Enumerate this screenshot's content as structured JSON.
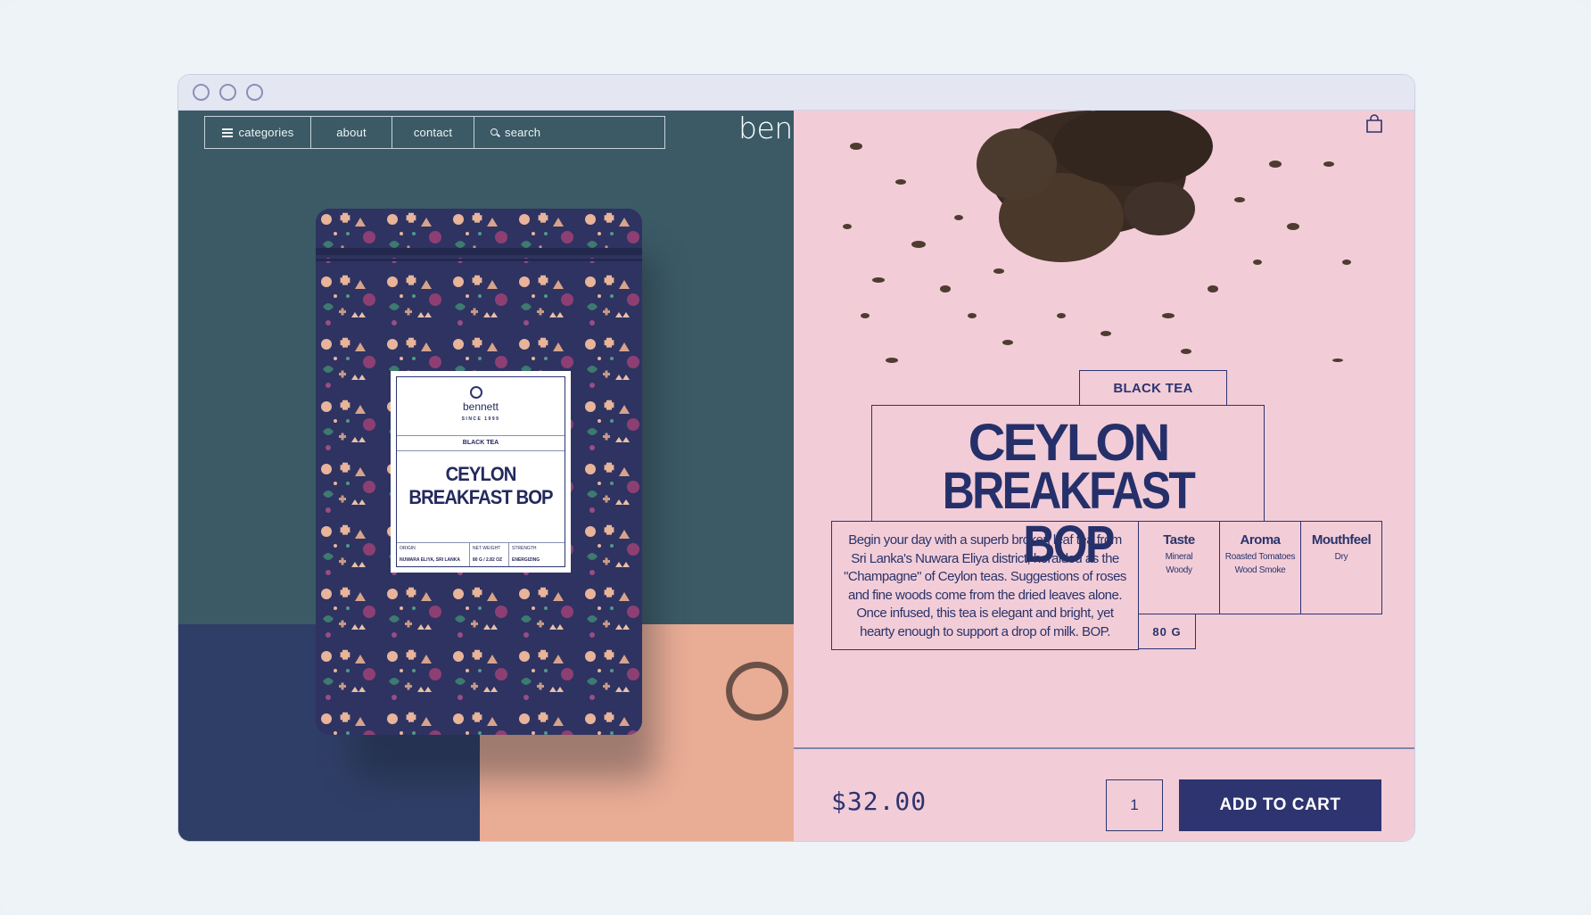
{
  "brand": {
    "name": "bennett"
  },
  "nav": {
    "categories": "categories",
    "about": "about",
    "contact": "contact",
    "search": "search"
  },
  "tin_label": {
    "brand": "bennett",
    "since": "SINCE 1999",
    "type": "BLACK TEA",
    "name_line1": "CEYLON",
    "name_line2": "BREAKFAST BOP",
    "origin_label": "ORIGIN",
    "origin_value": "NUWARA ELIYA, SRI LANKA",
    "weight_label": "NET WEIGHT",
    "weight_value": "80 G / 2.82 OZ",
    "strength_label": "STRENGTH",
    "strength_value": "ENERGIZING"
  },
  "product": {
    "type": "BLACK TEA",
    "title_line1": "CEYLON",
    "title_line2": "BREAKFAST BOP",
    "description": "Begin your day with a superb broken leaf tea from Sri Lanka's Nuwara Eliya district, heralded as the \"Champagne\" of Ceylon teas. Suggestions of roses and fine woods come from the dried leaves alone. Once infused, this tea is elegant and bright, yet hearty enough to support a drop of milk. BOP.",
    "attributes": [
      {
        "heading": "Taste",
        "values": [
          "Mineral",
          "Woody"
        ]
      },
      {
        "heading": "Aroma",
        "values": [
          "Roasted Tomatoes",
          "Wood Smoke"
        ]
      },
      {
        "heading": "Mouthfeel",
        "values": [
          "Dry"
        ]
      }
    ],
    "weight": "80 G",
    "price": "$32.00",
    "quantity": "1",
    "add_to_cart": "ADD TO CART"
  },
  "colors": {
    "teal": "#3b5a65",
    "navy": "#2f3e66",
    "peach": "#e9ac95",
    "pink": "#f2cdd7",
    "ink": "#2d3470"
  }
}
